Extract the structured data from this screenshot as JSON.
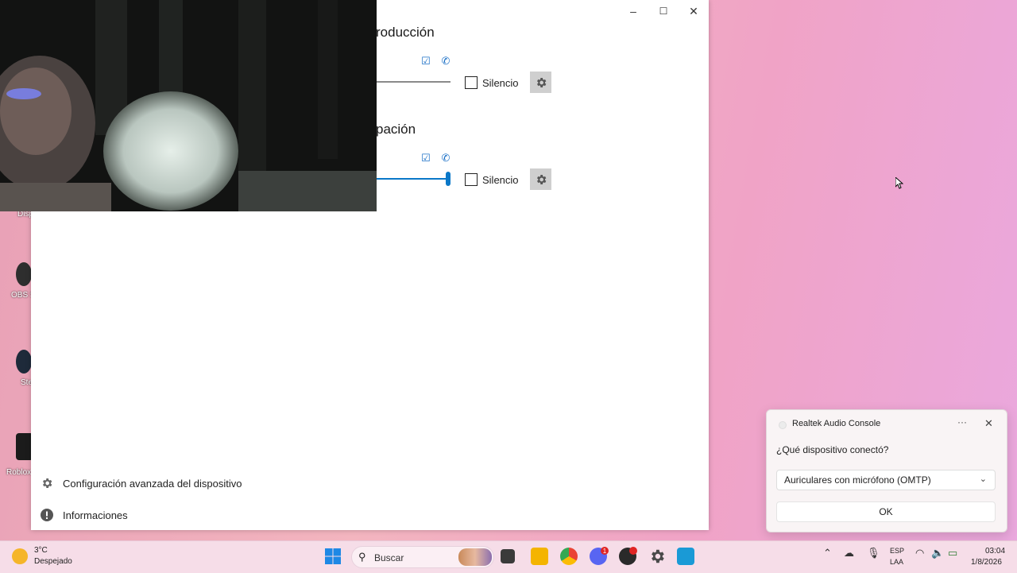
{
  "desktop": {
    "icons": [
      {
        "label": "Dispo"
      },
      {
        "label": "OBS S"
      },
      {
        "label": "Ste"
      },
      {
        "label": "Roblox"
      }
    ]
  },
  "window": {
    "controls": {
      "minimize": "–",
      "maximize": "☐",
      "close": "✕"
    },
    "playback": {
      "title": "roducción",
      "mute_label": "Silencio"
    },
    "recording": {
      "title": "pación",
      "mute_label": "Silencio"
    },
    "footer": {
      "advanced_label": "Configuración avanzada del dispositivo",
      "info_label": "Informaciones"
    }
  },
  "notification": {
    "app_name": "Realtek Audio Console",
    "more": "···",
    "close": "✕",
    "question": "¿Qué dispositivo conectó?",
    "selected_device": "Auriculares con micrófono (OMTP)",
    "ok_label": "OK"
  },
  "taskbar": {
    "weather_temp": "3°C",
    "weather_status": "Despejado",
    "search_placeholder": "Buscar",
    "discord_badge": "1",
    "lang_line1": "ESP",
    "lang_line2": "LAA",
    "time": "03:04",
    "date": "1/8/2026"
  },
  "colors": {
    "accent": "#0a78c8",
    "window_bg": "#ffffff",
    "taskbar_bg": "#f6dde8"
  }
}
